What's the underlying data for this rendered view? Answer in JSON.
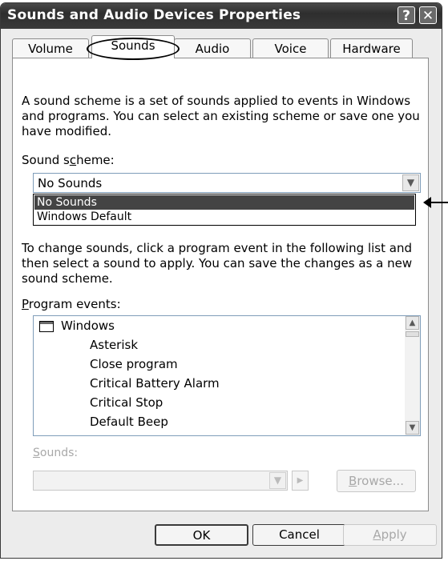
{
  "window": {
    "title": "Sounds and Audio Devices Properties",
    "help_icon": "?",
    "close_icon": "✕"
  },
  "tabs": [
    {
      "label": "Volume"
    },
    {
      "label": "Sounds",
      "active": true
    },
    {
      "label": "Audio"
    },
    {
      "label": "Voice"
    },
    {
      "label": "Hardware"
    }
  ],
  "sounds_tab": {
    "intro": "A sound scheme is a set of sounds applied to events in Windows and programs. You can select an existing scheme or save one you have modified.",
    "scheme_label_pre": "Sound s",
    "scheme_label_key": "c",
    "scheme_label_post": "heme:",
    "scheme_value": "No Sounds",
    "scheme_options": [
      "No Sounds",
      "Windows Default"
    ],
    "scheme_selected_option": "No Sounds",
    "change_help": "To change sounds, click a program event in the following list and then select a sound to apply. You can save the changes as a new sound scheme.",
    "events_label_key": "P",
    "events_label_post": "rogram events:",
    "events_root": "Windows",
    "events": [
      "Asterisk",
      "Close program",
      "Critical Battery Alarm",
      "Critical Stop",
      "Default Beep"
    ],
    "sounds_label_key": "S",
    "sounds_label_post": "ounds:",
    "browse_key": "B",
    "browse_post": "rowse..."
  },
  "buttons": {
    "ok": "OK",
    "cancel": "Cancel",
    "apply_key": "A",
    "apply_post": "pply"
  },
  "icons": {
    "dropdown": "chevron-down-icon",
    "scroll_up": "scroll-up-icon",
    "scroll_down": "scroll-down-icon",
    "play": "play-icon",
    "folder": "window-icon"
  }
}
